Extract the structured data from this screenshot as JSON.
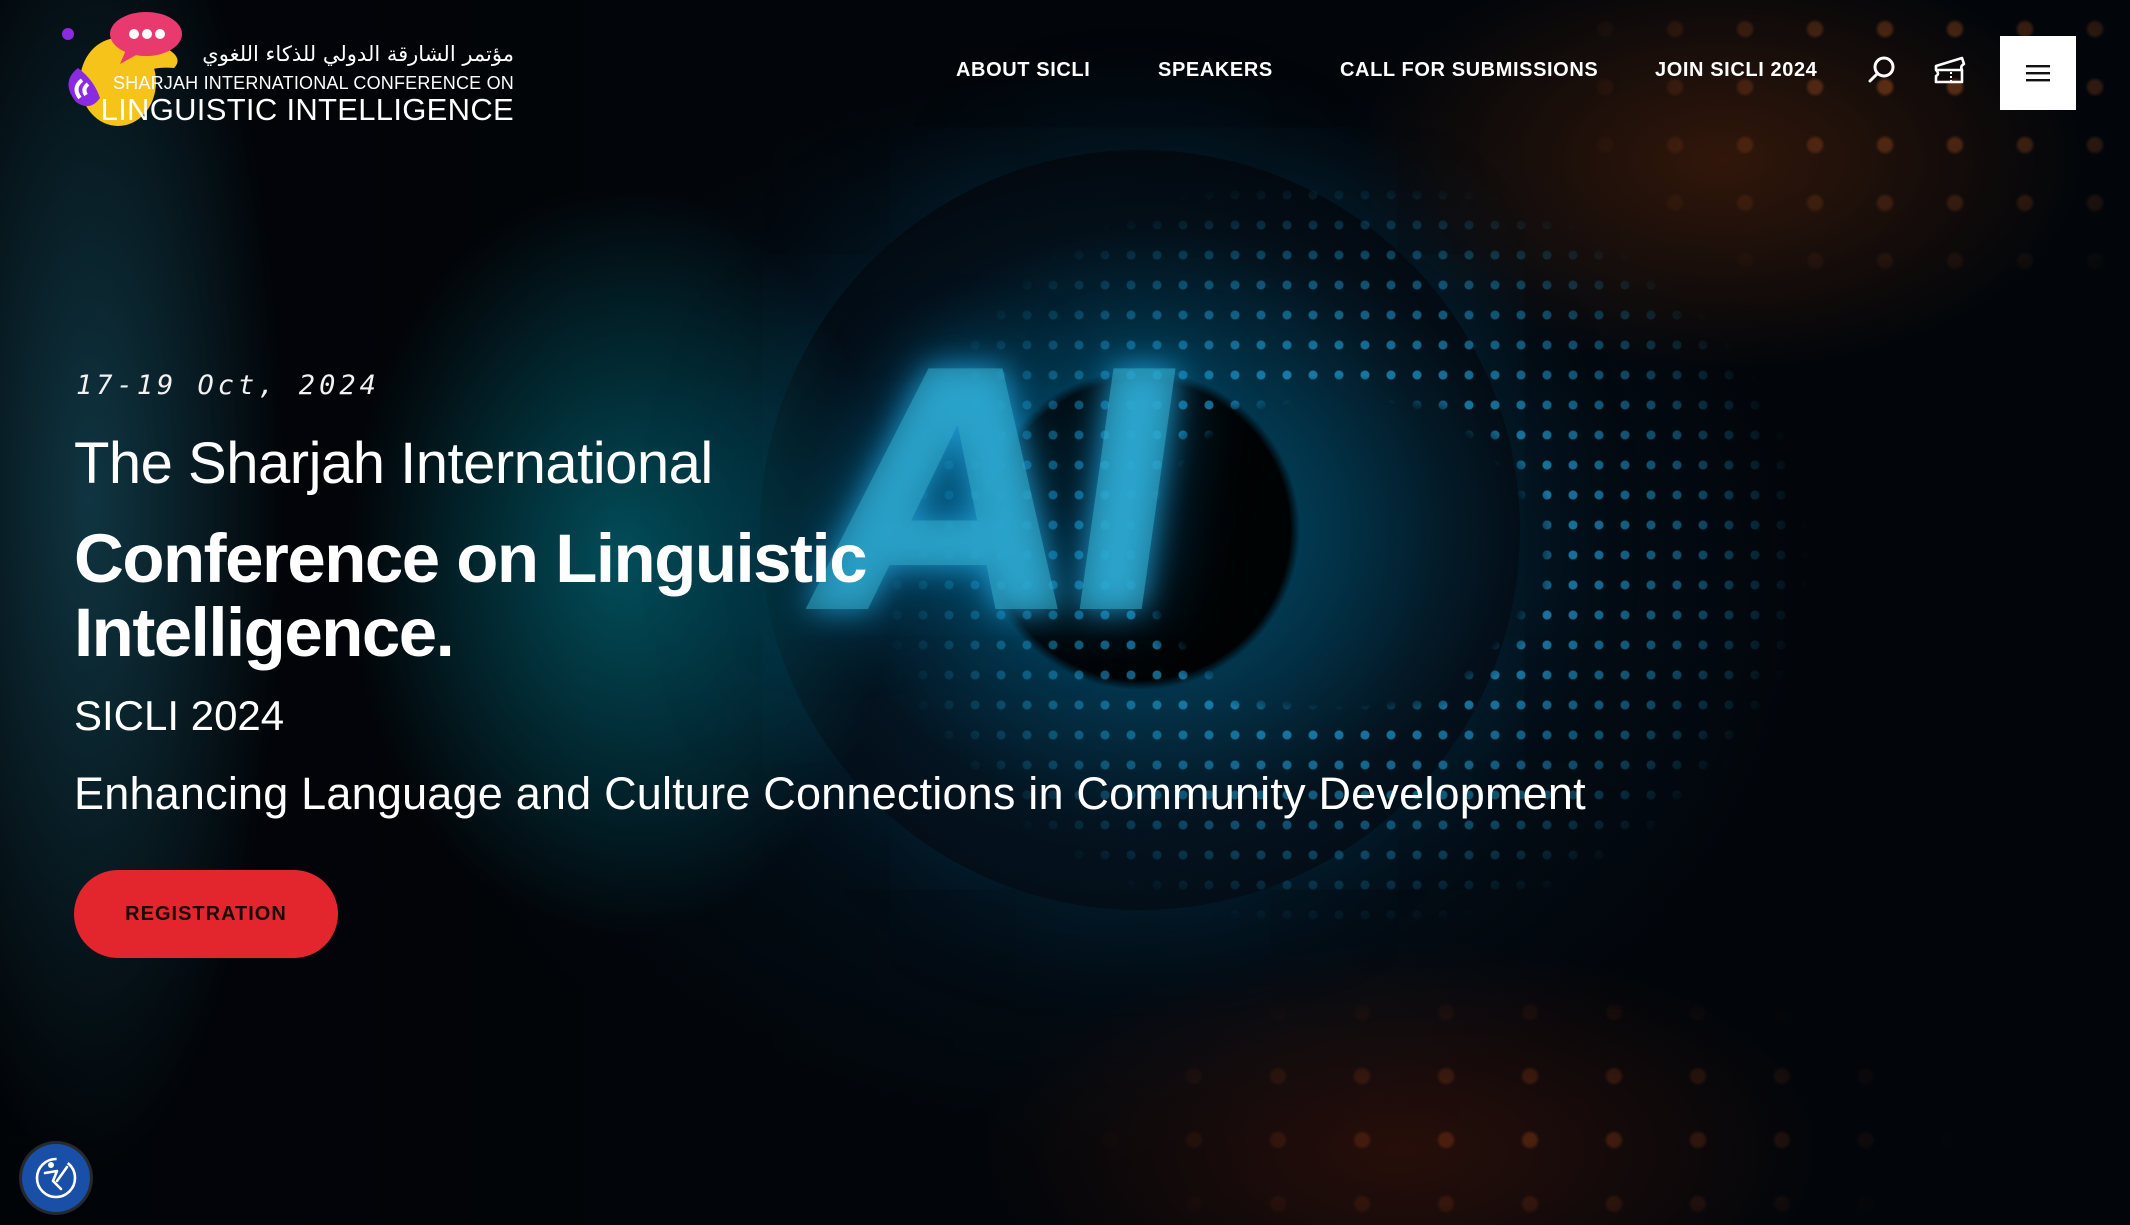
{
  "site": {
    "logo": {
      "arabic_name": "مؤتمر الشارقة الدولي للذكاء اللغوي",
      "english_line1": "SHARJAH INTERNATIONAL CONFERENCE ON",
      "english_line2": "LINGUISTIC INTELLIGENCE",
      "icon": "speech-bubble-head-logo-icon"
    }
  },
  "nav": {
    "items": [
      {
        "label": "ABOUT SICLI"
      },
      {
        "label": "SPEAKERS"
      },
      {
        "label": "CALL FOR SUBMISSIONS"
      },
      {
        "label": "JOIN SICLI 2024"
      }
    ],
    "search_icon": "search-icon",
    "ticket_icon": "ticket-icon",
    "menu_icon": "hamburger-menu-icon"
  },
  "hero": {
    "date": "17-19 Oct, 2024",
    "line1": "The Sharjah International",
    "title_line1": "Conference on Linguistic",
    "title_line2": "Intelligence.",
    "acronym": "SICLI 2024",
    "tagline": "Enhancing Language and Culture Connections in Community Development",
    "cta_label": "REGISTRATION",
    "background_text": "AI"
  },
  "accessibility": {
    "icon": "accessibility-icon"
  },
  "colors": {
    "cta": "#e3262e",
    "accessibility_button": "#1a4fa7",
    "logo_yellow": "#f6c31b",
    "logo_pink": "#e83a6e",
    "logo_purple": "#8a2be2"
  }
}
